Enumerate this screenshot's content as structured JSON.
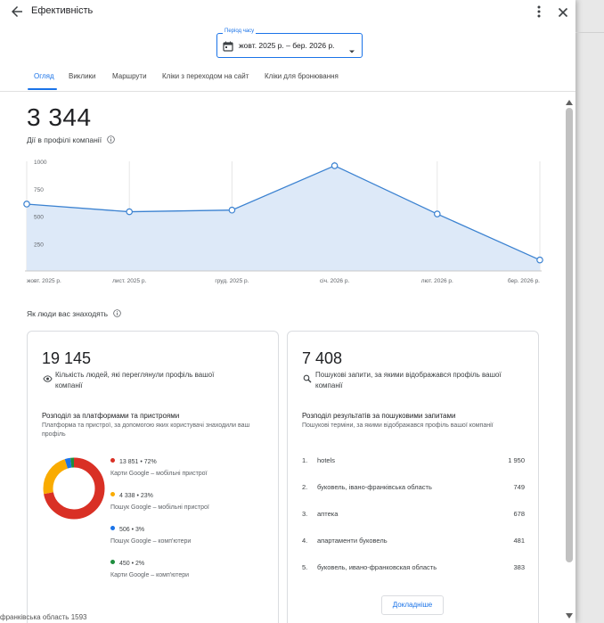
{
  "header": {
    "title": "Ефективність",
    "period_label": "Період часу",
    "period_value": "жовт. 2025 р. – бер. 2026 р."
  },
  "tabs": [
    {
      "label": "Огляд",
      "active": true
    },
    {
      "label": "Виклики"
    },
    {
      "label": "Маршрути"
    },
    {
      "label": "Кліки з переходом на сайт"
    },
    {
      "label": "Кліки для бронювання"
    }
  ],
  "summary": {
    "total": "3 344",
    "label": "Дії в профілі компанії"
  },
  "chart_data": {
    "type": "area",
    "y_ticks": [
      "1000",
      "750",
      "500",
      "250"
    ],
    "ylim": [
      0,
      1000
    ],
    "categories": [
      "жовт. 2025 р.",
      "лист. 2025 р.",
      "груд. 2025 р.",
      "січ. 2026 р.",
      "лют. 2026 р.",
      "бер. 2026 р."
    ],
    "values": [
      610,
      540,
      555,
      960,
      520,
      100
    ],
    "colors": {
      "line": "#3b82d1",
      "fill": "#dde9f8"
    },
    "grid": false
  },
  "discovery": {
    "label": "Як люди вас знаходять",
    "views_card": {
      "total": "19 145",
      "subtitle": "Кількість людей, які переглянули профіль вашої компанії",
      "section_title": "Розподіл за платформами та пристроями",
      "section_desc": "Платформа та пристрої, за допомогою яких користувачі знаходили ваш профіль",
      "breakdown": [
        {
          "stat": "13 851 • 72%",
          "desc": "Карти Google – мобільні пристрої",
          "percent": 72,
          "color": "#d93025"
        },
        {
          "stat": "4 338 • 23%",
          "desc": "Пошук Google – мобільні пристрої",
          "percent": 23,
          "color": "#f9ab00"
        },
        {
          "stat": "506 • 3%",
          "desc": "Пошук Google – комп'ютери",
          "percent": 3,
          "color": "#1a73e8"
        },
        {
          "stat": "450 • 2%",
          "desc": "Карти Google – комп'ютери",
          "percent": 2,
          "color": "#1e8e3e"
        }
      ]
    },
    "search_card": {
      "total": "7 408",
      "subtitle": "Пошукові запити, за якими відображався профіль вашої компанії",
      "section_title": "Розподіл результатів за пошуковими запитами",
      "section_desc": "Пошукові терміни, за якими відображався профіль вашої компанії",
      "queries": [
        {
          "idx": "1.",
          "term": "hotels",
          "count": "1 950"
        },
        {
          "idx": "2.",
          "term": "буковель, івано-франківська область",
          "count": "749"
        },
        {
          "idx": "3.",
          "term": "аптека",
          "count": "678"
        },
        {
          "idx": "4.",
          "term": "апартаменти буковель",
          "count": "481"
        },
        {
          "idx": "5.",
          "term": "буковель, ивано-франковская область",
          "count": "383"
        }
      ],
      "more_label": "Докладніше"
    }
  },
  "icons": {
    "back": "arrow-back-icon",
    "more": "more-vert-icon",
    "close": "close-icon",
    "calendar": "calendar-icon",
    "dropdown": "dropdown-arrow-icon",
    "info": "info-icon",
    "eye": "eye-icon",
    "search": "search-icon"
  },
  "background": {
    "partial_text": "франківська область 1593"
  }
}
